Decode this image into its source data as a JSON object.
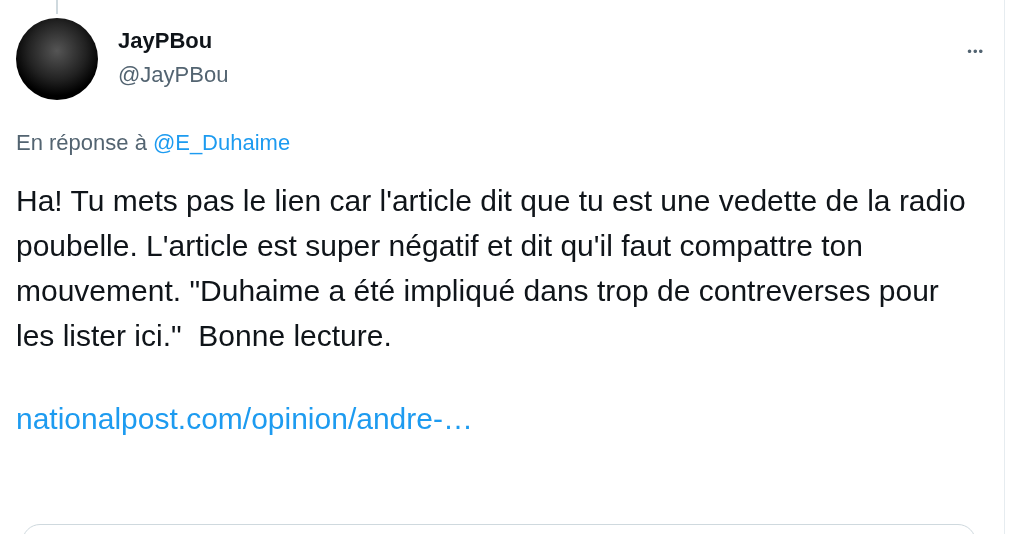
{
  "tweet": {
    "author_name": "JayPBou",
    "author_handle": "@JayPBou",
    "more": "•••",
    "reply_prefix": "En réponse à",
    "reply_to": "@E_Duhaime",
    "body": "Ha! Tu mets pas le lien car l'article dit que tu est une vedette de la radio poubelle. L'article est super négatif et dit qu'il faut compattre ton mouvement. \"Duhaime a été impliqué dans trop de contreverses pour les lister ici.\"  Bonne lecture.",
    "link": "nationalpost.com/opinion/andre-…"
  }
}
